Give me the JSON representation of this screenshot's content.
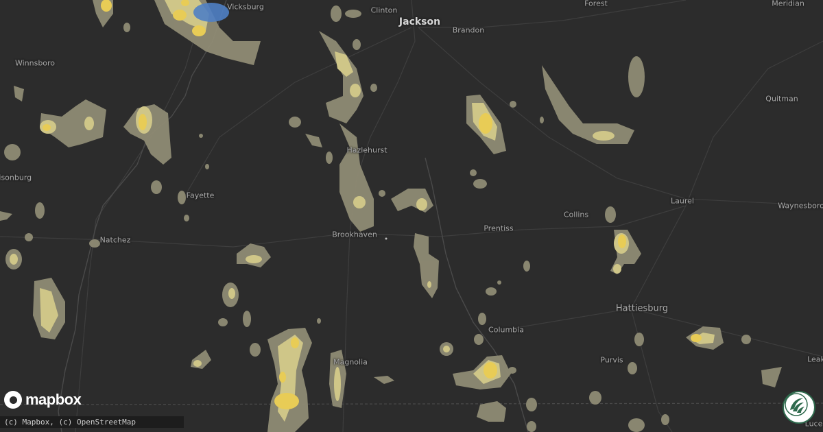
{
  "map": {
    "cities": [
      {
        "name": "Vicksburg",
        "major": false
      },
      {
        "name": "Clinton",
        "major": false
      },
      {
        "name": "Jackson",
        "major": true
      },
      {
        "name": "Brandon",
        "major": false
      },
      {
        "name": "Forest",
        "major": false
      },
      {
        "name": "Meridian",
        "major": false
      },
      {
        "name": "Winnsboro",
        "major": false
      },
      {
        "name": "Quitman",
        "major": false
      },
      {
        "name": "Hazlehurst",
        "major": false
      },
      {
        "name": "risonburg",
        "major": false
      },
      {
        "name": "Fayette",
        "major": false
      },
      {
        "name": "Laurel",
        "major": false
      },
      {
        "name": "Waynesboro",
        "major": false
      },
      {
        "name": "Collins",
        "major": false
      },
      {
        "name": "Prentiss",
        "major": false
      },
      {
        "name": "Brookhaven",
        "major": false
      },
      {
        "name": "Natchez",
        "major": false
      },
      {
        "name": "Hattiesburg",
        "major": false
      },
      {
        "name": "Columbia",
        "major": false
      },
      {
        "name": "Purvis",
        "major": false
      },
      {
        "name": "Magnolia",
        "major": false
      },
      {
        "name": "Leak",
        "major": false
      },
      {
        "name": "Luced",
        "major": false
      }
    ],
    "colors": {
      "background": "#2c2c2c",
      "precip_light": "#8f8b74",
      "precip_moderate": "#d2c786",
      "precip_heavy": "#e8cc56",
      "precip_snow_blue": "#4f7fc4",
      "roads": "#3d3d3d"
    }
  },
  "footer": {
    "logo_text": "mapbox",
    "attribution": "(c) Mapbox, (c) OpenStreetMap",
    "brand_icon": "weather-swirl-icon"
  }
}
